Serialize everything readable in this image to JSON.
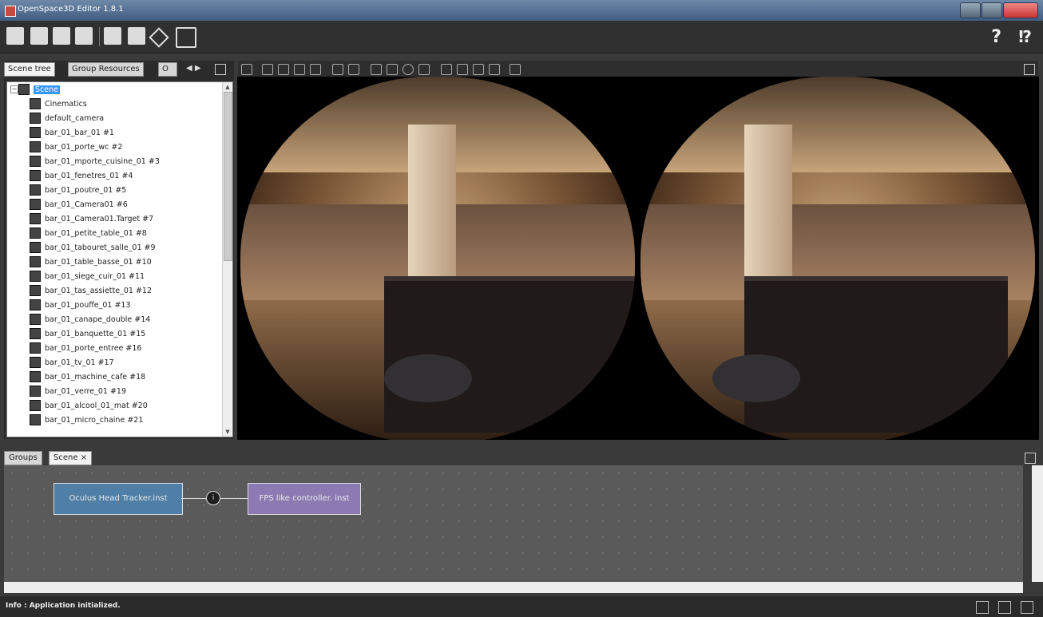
{
  "window": {
    "title": "OpenSpace3D Editor 1.8.1"
  },
  "help": {
    "help_glyph": "?",
    "help2_glyph": "⁉"
  },
  "scene_panel": {
    "tabs": [
      "Scene tree",
      "Group Resources",
      "O"
    ],
    "root": "Scene",
    "items": [
      "Cinematics",
      "default_camera",
      "bar_01_bar_01 #1",
      "bar_01_porte_wc #2",
      "bar_01_mporte_cuisine_01 #3",
      "bar_01_fenetres_01 #4",
      "bar_01_poutre_01 #5",
      "bar_01_Camera01 #6",
      "bar_01_Camera01.Target #7",
      "bar_01_petite_table_01 #8",
      "bar_01_tabouret_salle_01 #9",
      "bar_01_table_basse_01 #10",
      "bar_01_siege_cuir_01 #11",
      "bar_01_tas_assiette_01 #12",
      "bar_01_pouffe_01 #13",
      "bar_01_canape_double #14",
      "bar_01_banquette_01 #15",
      "bar_01_porte_entree #16",
      "bar_01_tv_01 #17",
      "bar_01_machine_cafe #18",
      "bar_01_verre_01 #19",
      "bar_01_alcool_01_mat #20",
      "bar_01_micro_chaine #21"
    ]
  },
  "bottom_panel": {
    "tabs": [
      "Groups",
      "Scene"
    ],
    "tab_close": "×",
    "nodes": {
      "node1": "Oculus Head Tracker.inst",
      "node2": "FPS like controller. inst",
      "connector": "i"
    }
  },
  "status": {
    "text": "Info : Application initialized."
  }
}
